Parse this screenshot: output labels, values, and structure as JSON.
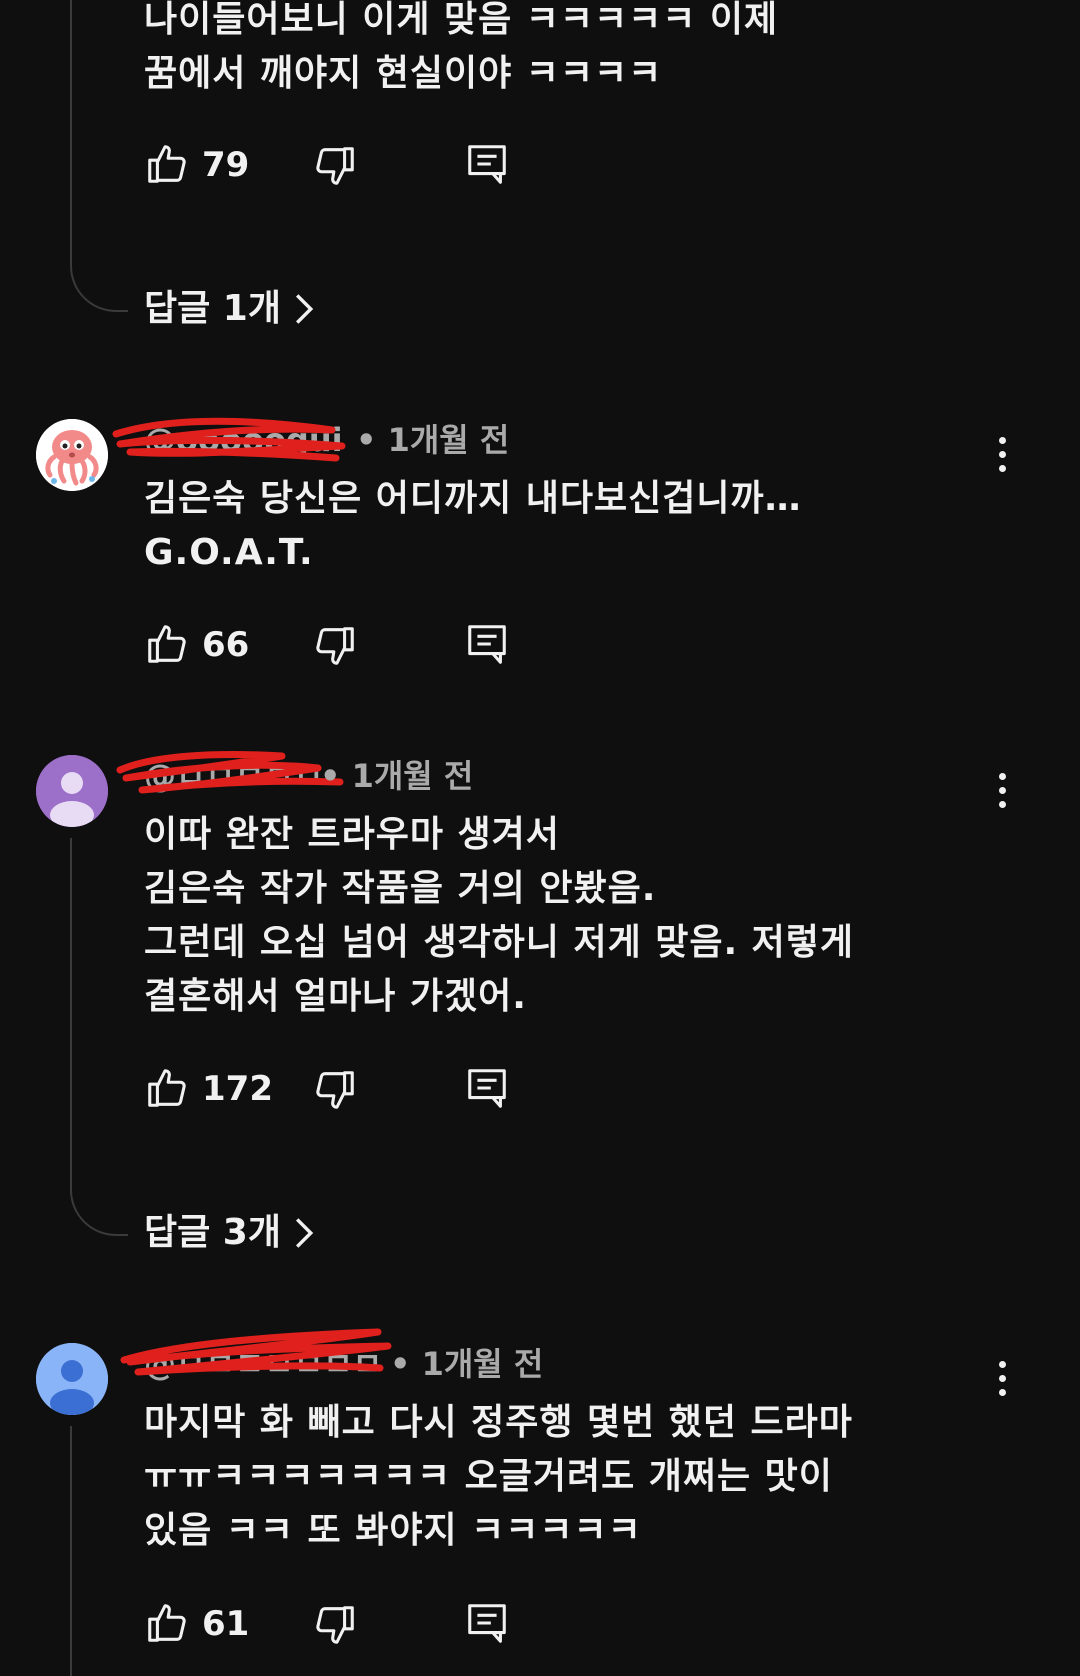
{
  "prev_comment": {
    "text": "나이들어보니 이게 맞음 ㅋㅋㅋㅋㅋ 이제\n꿈에서 깨야지 현실이야 ㅋㅋㅋㅋ",
    "like_count": "79",
    "replies_label": "답글 1개"
  },
  "comments": [
    {
      "author": "@oooooqui",
      "time": "• 1개월 전",
      "text": "김은숙 당신은 어디까지 내다보신겁니까…\nG.O.A.T.",
      "like_count": "66"
    },
    {
      "author": "@ㅁㅁㅁㅁㅁ",
      "time": "• 1개월 전",
      "text": "이따 완잔 트라우마 생겨서\n김은숙 작가 작품을 거의 안봤음.\n그런데 오십 넘어 생각하니 저게 맞음. 저렇게\n결혼해서 얼마나 가겠어.",
      "like_count": "172",
      "replies_label": "답글 3개"
    },
    {
      "author": "@ㅁㅁㅁㅁㅁㅁㅁ",
      "time": "• 1개월 전",
      "text": "마지막 화 빼고 다시 정주행 몇번 했던 드라마\nㅠㅠㅋㅋㅋㅋㅋㅋㅋ 오글거려도 개쩌는 맛이\n있음 ㅋㅋ 또 봐야지 ㅋㅋㅋㅋㅋ",
      "like_count": "61"
    }
  ],
  "colors": {
    "background": "#0f0f0f",
    "text": "#f1f1f1",
    "meta": "#aaaaaa",
    "thread_line": "#3a3a3a",
    "redaction": "#e0201c",
    "avatar_purple": "#9c6fc9",
    "avatar_blue": "#8ab4f8"
  },
  "icons": {
    "like": "thumbs-up-icon",
    "dislike": "thumbs-down-icon",
    "reply": "reply-comment-icon",
    "more": "more-vertical-icon",
    "chevron": "chevron-right-icon"
  }
}
